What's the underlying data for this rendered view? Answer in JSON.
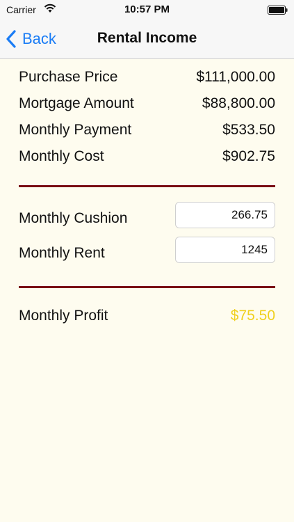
{
  "status_bar": {
    "carrier": "Carrier",
    "time": "10:57 PM"
  },
  "nav": {
    "back_label": "Back",
    "title": "Rental Income"
  },
  "summary": [
    {
      "label": "Purchase Price",
      "value": "$111,000.00"
    },
    {
      "label": "Mortgage Amount",
      "value": "$88,800.00"
    },
    {
      "label": "Monthly Payment",
      "value": "$533.50"
    },
    {
      "label": "Monthly Cost",
      "value": "$902.75"
    }
  ],
  "inputs": {
    "cushion_label": "Monthly Cushion",
    "cushion_value": "266.75",
    "rent_label": "Monthly Rent",
    "rent_value": "1245"
  },
  "result": {
    "profit_label": "Monthly Profit",
    "profit_value": "$75.50"
  },
  "colors": {
    "accent": "#1a7cf5",
    "divider": "#7a0e14",
    "profit": "#f0d01e",
    "background": "#fefcef"
  }
}
